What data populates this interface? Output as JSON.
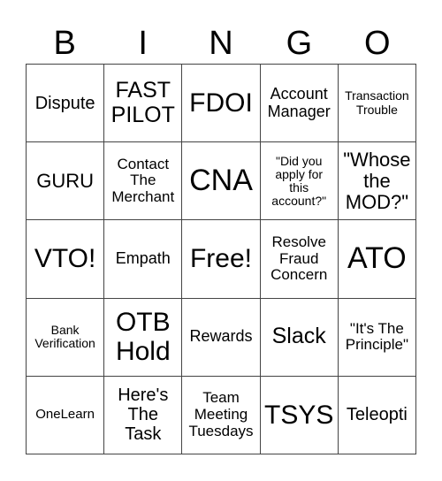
{
  "header": [
    "B",
    "I",
    "N",
    "G",
    "O"
  ],
  "cells": [
    "Dispute",
    "FAST\nPILOT",
    "FDOI",
    "Account\nManager",
    "Transaction\nTrouble",
    "GURU",
    "Contact\nThe\nMerchant",
    "CNA",
    "\"Did you\napply for\nthis\naccount?\"",
    "\"Whose\nthe\nMOD?\"",
    "VTO!",
    "Empath",
    "Free!",
    "Resolve\nFraud\nConcern",
    "ATO",
    "Bank\nVerification",
    "OTB\nHold",
    "Rewards",
    "Slack",
    "\"It's The\nPrinciple\"",
    "OneLearn",
    "Here's\nThe\nTask",
    "Team\nMeeting\nTuesdays",
    "TSYS",
    "Teleopti"
  ]
}
